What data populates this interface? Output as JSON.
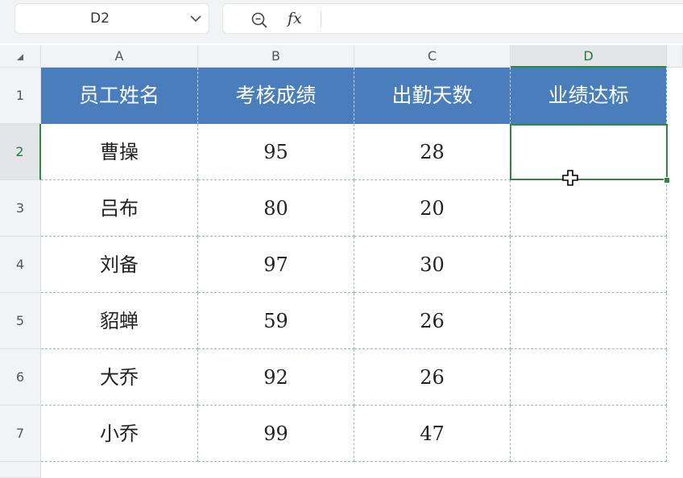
{
  "name_box": {
    "value": "D2"
  },
  "formula_bar": {
    "fx_label": "fx",
    "value": ""
  },
  "columns": [
    "A",
    "B",
    "C",
    "D"
  ],
  "rows": [
    "1",
    "2",
    "3",
    "4",
    "5",
    "6",
    "7"
  ],
  "active_cell": {
    "column": "D",
    "row": "2"
  },
  "table": {
    "headers": [
      "员工姓名",
      "考核成绩",
      "出勤天数",
      "业绩达标"
    ],
    "rows": [
      [
        "曹操",
        "95",
        "28",
        ""
      ],
      [
        "吕布",
        "80",
        "20",
        ""
      ],
      [
        "刘备",
        "97",
        "30",
        ""
      ],
      [
        "貂蝉",
        "59",
        "26",
        ""
      ],
      [
        "大乔",
        "92",
        "26",
        ""
      ],
      [
        "小乔",
        "99",
        "47",
        ""
      ]
    ]
  },
  "colors": {
    "header_fill": "#4a7dbb",
    "selection": "#2b8a3e",
    "gridline": "#9fb3c8"
  }
}
